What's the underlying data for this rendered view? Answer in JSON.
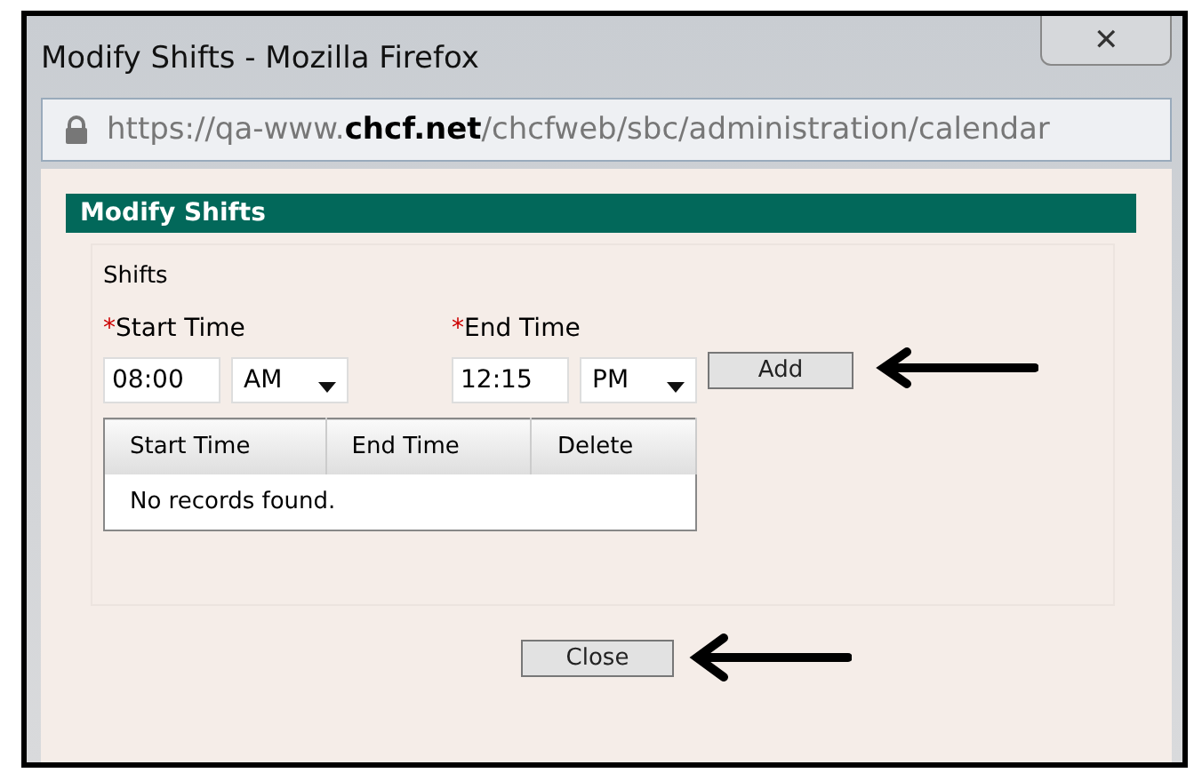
{
  "window": {
    "title": "Modify Shifts - Mozilla Firefox",
    "close": "✕"
  },
  "address_bar": {
    "url": "https://qa-www.**chcf.net**/chcfweb/sbc/administration/calendar"
  },
  "panel": {
    "title": "Modify Shifts",
    "section": "Shifts",
    "start": {
      "label": "Start Time",
      "required": "*",
      "time": "08:00",
      "period": "AM"
    },
    "end": {
      "label": "End Time",
      "required": "*",
      "time": "12:15",
      "period": "PM"
    },
    "add_button": "Add",
    "table": {
      "columns": [
        "Start Time",
        "End Time",
        "Delete"
      ],
      "empty": "No records found."
    },
    "close_button": "Close"
  }
}
